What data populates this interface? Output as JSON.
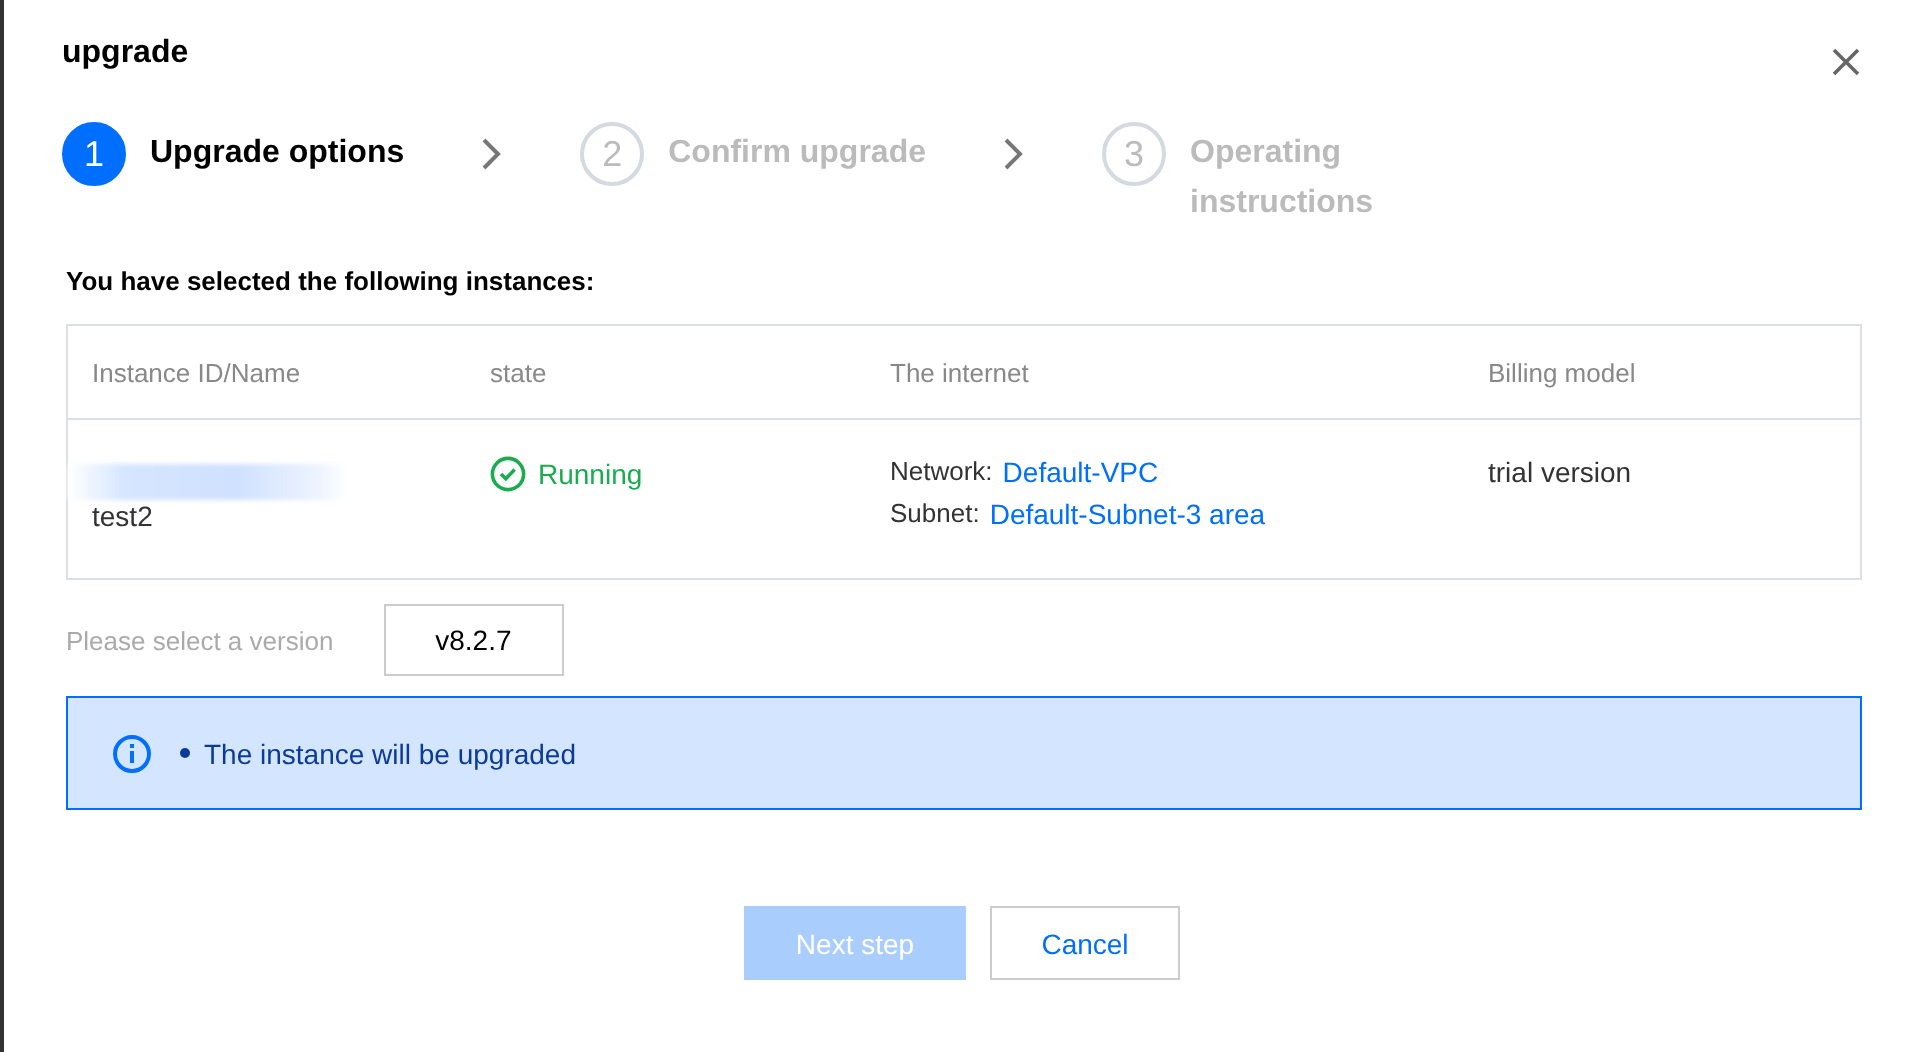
{
  "dialog": {
    "title": "upgrade"
  },
  "steps": [
    {
      "number": "1",
      "label": "Upgrade options",
      "selected": true
    },
    {
      "number": "2",
      "label": "Confirm upgrade",
      "selected": false
    },
    {
      "number": "3",
      "label": "Operating instructions",
      "selected": false
    }
  ],
  "heading": "You have selected the following instances:",
  "table": {
    "columns": [
      "Instance ID/Name",
      "state",
      "The internet",
      "Billing model"
    ],
    "rows": [
      {
        "name": "test2",
        "state": "Running",
        "network_label": "Network:",
        "network": "Default-VPC",
        "subnet_label": "Subnet:",
        "subnet": "Default-Subnet-3 area",
        "billing": "trial version"
      }
    ]
  },
  "version": {
    "label": "Please select a version",
    "value": "v8.2.7"
  },
  "notice": {
    "items": [
      "The instance will be upgraded"
    ]
  },
  "buttons": [
    {
      "label": "Next step",
      "kind": "primary",
      "disabled": true
    },
    {
      "label": "Cancel",
      "kind": "secondary",
      "disabled": false
    }
  ]
}
